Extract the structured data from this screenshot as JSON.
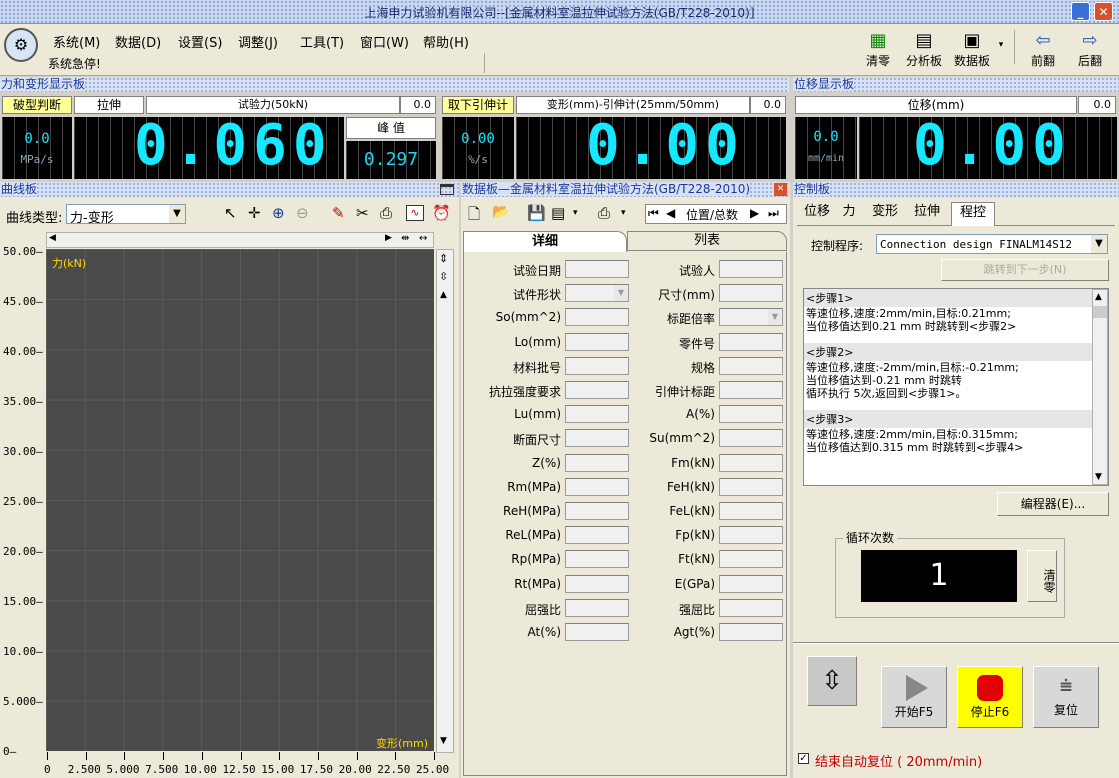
{
  "window": {
    "title": "上海申力试验机有限公司--[金属材料室温拉伸试验方法(GB/T228-2010)]"
  },
  "menu": {
    "items": [
      "系统(M)",
      "数据(D)",
      "设置(S)",
      "调整(J)",
      "工具(T)",
      "窗口(W)",
      "帮助(H)"
    ],
    "status": "系统急停!"
  },
  "toolbar": {
    "zero": "清零",
    "analysis": "分析板",
    "databoard": "数据板",
    "prev": "前翻",
    "next": "后翻"
  },
  "force_panel": {
    "title": "力和变形显示板",
    "break_label": "破型判断",
    "mode": "拉伸",
    "force_label": "试验力(50kN)",
    "force_range": "0.0",
    "stress": "0.0",
    "stress_unit": "MPa/s",
    "force_value": "0.060",
    "peak_label": "峰  值",
    "peak_value": "0.297",
    "remove_ext": "取下引伸计",
    "deform_label": "变形(mm)-引伸计(25mm/50mm)",
    "deform_range": "0.0",
    "strain_rate": "0.00",
    "strain_unit": "%/s",
    "deform_value": "0.00"
  },
  "disp_panel": {
    "title": "位移显示板",
    "label": "位移(mm)",
    "range": "0.0",
    "speed": "0.0",
    "speed_unit": "mm/min",
    "value": "0.00"
  },
  "curve_panel": {
    "title": "曲线板",
    "curve_type_label": "曲线类型:",
    "curve_type": "力-变形",
    "y_title": "力(kN)",
    "x_title": "变形(mm)"
  },
  "chart_data": {
    "type": "line",
    "xlabel": "变形(mm)",
    "ylabel": "力(kN)",
    "xlim": [
      0,
      25
    ],
    "ylim": [
      0,
      50
    ],
    "yticks": [
      "50.00",
      "45.00",
      "40.00",
      "35.00",
      "30.00",
      "25.00",
      "20.00",
      "15.00",
      "10.00",
      "5.000",
      "0"
    ],
    "xticks": [
      "0",
      "2.500",
      "5.000",
      "7.500",
      "10.00",
      "12.50",
      "15.00",
      "17.50",
      "20.00",
      "22.50",
      "25.00"
    ],
    "series": []
  },
  "data_panel": {
    "title": "数据板—金属材料室温拉伸试验方法(GB/T228-2010)",
    "nav_label": "位置/总数",
    "tab_detail": "详细",
    "tab_list": "列表",
    "left_fields": [
      "试验日期",
      "试件形状",
      "So(mm^2)",
      "Lo(mm)",
      "材料批号",
      "抗拉强度要求",
      "Lu(mm)",
      "断面尺寸",
      "Z(%)",
      "Rm(MPa)",
      "ReH(MPa)",
      "ReL(MPa)",
      "Rp(MPa)",
      "Rt(MPa)",
      "屈强比",
      "At(%)"
    ],
    "right_fields": [
      "试验人",
      "尺寸(mm)",
      "标距倍率",
      "零件号",
      "规格",
      "引伸计标距",
      "A(%)",
      "Su(mm^2)",
      "Fm(kN)",
      "FeH(kN)",
      "FeL(kN)",
      "Fp(kN)",
      "Ft(kN)",
      "E(GPa)",
      "强屈比",
      "Agt(%)"
    ]
  },
  "control_panel": {
    "title": "控制板",
    "tabs": [
      "位移",
      "力",
      "变形",
      "拉伸",
      "程控"
    ],
    "program_label": "控制程序:",
    "program": "Connection design FINALM14S12",
    "skip_button": "跳转到下一步(N)",
    "steps": [
      {
        "head": "<步骤1>",
        "lines": [
          "等速位移,速度:2mm/min,目标:0.21mm;",
          "当位移值达到0.21 mm 时跳转到<步骤2>"
        ]
      },
      {
        "head": "<步骤2>",
        "lines": [
          "等速位移,速度:-2mm/min,目标:-0.21mm;",
          "当位移值达到-0.21 mm 时跳转",
          "循环执行 5次,返回到<步骤1>。"
        ]
      },
      {
        "head": "<步骤3>",
        "lines": [
          "等速位移,速度:2mm/min,目标:0.315mm;",
          "当位移值达到0.315 mm 时跳转到<步骤4>"
        ]
      }
    ],
    "editor_button": "编程器(E)...",
    "cycle_label": "循环次数",
    "cycle_value": "1",
    "cycle_clear": "清零",
    "start": "开始F5",
    "stop": "停止F6",
    "reset": "复位",
    "auto_reset": "结束自动复位 ( 20mm/min)"
  }
}
